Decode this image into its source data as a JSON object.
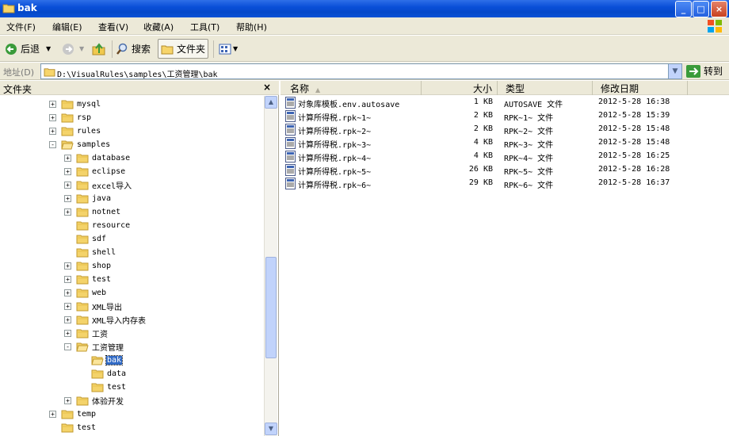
{
  "window": {
    "title": "bak"
  },
  "menu": [
    "文件(F)",
    "编辑(E)",
    "查看(V)",
    "收藏(A)",
    "工具(T)",
    "帮助(H)"
  ],
  "toolbar": {
    "back": "后退",
    "search": "搜索",
    "folders": "文件夹"
  },
  "address": {
    "label": "地址(D)",
    "path": "D:\\VisualRules\\samples\\工资管理\\bak",
    "go": "转到"
  },
  "folders_pane": {
    "title": "文件夹"
  },
  "tree": [
    {
      "label": "mysql",
      "expander": "+"
    },
    {
      "label": "rsp",
      "expander": "+"
    },
    {
      "label": "rules",
      "expander": "+"
    },
    {
      "label": "samples",
      "expander": "-"
    },
    {
      "label": "database",
      "expander": "+"
    },
    {
      "label": "eclipse",
      "expander": "+"
    },
    {
      "label": "excel导入",
      "expander": "+"
    },
    {
      "label": "java",
      "expander": "+"
    },
    {
      "label": "notnet",
      "expander": "+"
    },
    {
      "label": "resource",
      "expander": ""
    },
    {
      "label": "sdf",
      "expander": ""
    },
    {
      "label": "shell",
      "expander": ""
    },
    {
      "label": "shop",
      "expander": "+"
    },
    {
      "label": "test",
      "expander": "+"
    },
    {
      "label": "web",
      "expander": "+"
    },
    {
      "label": "XML导出",
      "expander": "+"
    },
    {
      "label": "XML导入内存表",
      "expander": "+"
    },
    {
      "label": "工资",
      "expander": "+"
    },
    {
      "label": "工资管理",
      "expander": "-"
    },
    {
      "label": "bak",
      "expander": ""
    },
    {
      "label": "data",
      "expander": ""
    },
    {
      "label": "test",
      "expander": ""
    },
    {
      "label": "体验开发",
      "expander": "+"
    },
    {
      "label": "temp",
      "expander": "+"
    },
    {
      "label": "test",
      "expander": ""
    }
  ],
  "columns": {
    "name": "名称",
    "size": "大小",
    "type": "类型",
    "modified": "修改日期"
  },
  "files": [
    {
      "name": "对象库模板.env.autosave",
      "size": "1 KB",
      "type": "AUTOSAVE 文件",
      "modified": "2012-5-28 16:38"
    },
    {
      "name": "计算所得税.rpk~1~",
      "size": "2 KB",
      "type": "RPK~1~ 文件",
      "modified": "2012-5-28 15:39"
    },
    {
      "name": "计算所得税.rpk~2~",
      "size": "2 KB",
      "type": "RPK~2~ 文件",
      "modified": "2012-5-28 15:48"
    },
    {
      "name": "计算所得税.rpk~3~",
      "size": "4 KB",
      "type": "RPK~3~ 文件",
      "modified": "2012-5-28 15:48"
    },
    {
      "name": "计算所得税.rpk~4~",
      "size": "4 KB",
      "type": "RPK~4~ 文件",
      "modified": "2012-5-28 16:25"
    },
    {
      "name": "计算所得税.rpk~5~",
      "size": "26 KB",
      "type": "RPK~5~ 文件",
      "modified": "2012-5-28 16:28"
    },
    {
      "name": "计算所得税.rpk~6~",
      "size": "29 KB",
      "type": "RPK~6~ 文件",
      "modified": "2012-5-28 16:37"
    }
  ],
  "colors": {
    "title_blue": "#0a4fd8",
    "selection": "#316ac5",
    "chrome": "#ece9d8"
  }
}
